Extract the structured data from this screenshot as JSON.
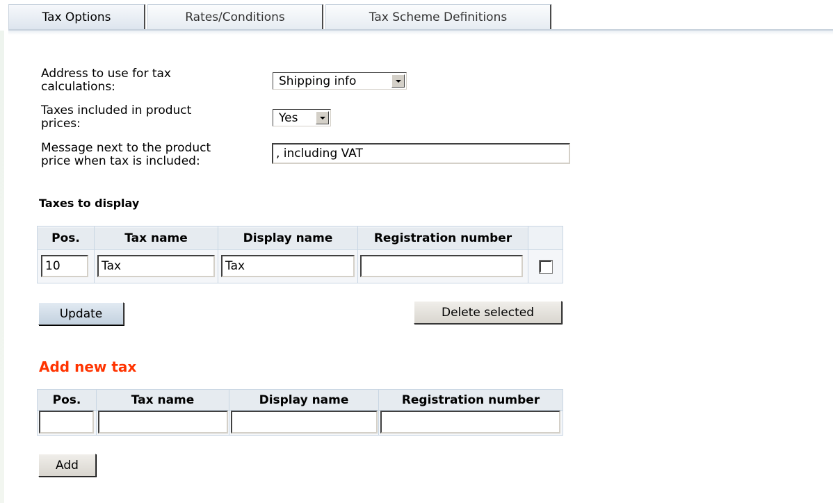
{
  "tabs": [
    {
      "label": "Tax Options",
      "active": true
    },
    {
      "label": "Rates/Conditions",
      "active": false
    },
    {
      "label": "Tax Scheme Definitions",
      "active": false
    }
  ],
  "settings": {
    "address_label_line1": "Address to use for tax",
    "address_label_line2": "calculations:",
    "address_value": "Shipping info",
    "included_label_line1": "Taxes included in product",
    "included_label_line2": "prices:",
    "included_value": "Yes",
    "message_label_line1": "Message next to the product",
    "message_label_line2": "price when tax is included:",
    "message_value": ", including VAT"
  },
  "taxes_table": {
    "title": "Taxes to display",
    "headers": [
      "Pos.",
      "Tax name",
      "Display name",
      "Registration number"
    ],
    "rows": [
      {
        "pos": "10",
        "tax_name": "Tax",
        "display_name": "Tax",
        "registration_number": "",
        "selected": false
      }
    ],
    "update_label": "Update",
    "delete_label": "Delete selected"
  },
  "add_tax": {
    "title": "Add new tax",
    "headers": [
      "Pos.",
      "Tax name",
      "Display name",
      "Registration number"
    ],
    "values": {
      "pos": "",
      "tax_name": "",
      "display_name": "",
      "registration_number": ""
    },
    "add_label": "Add"
  },
  "colors": {
    "accent_red": "#ff3300",
    "table_border": "#c9d6e3",
    "update_button": "#c3d1df"
  }
}
